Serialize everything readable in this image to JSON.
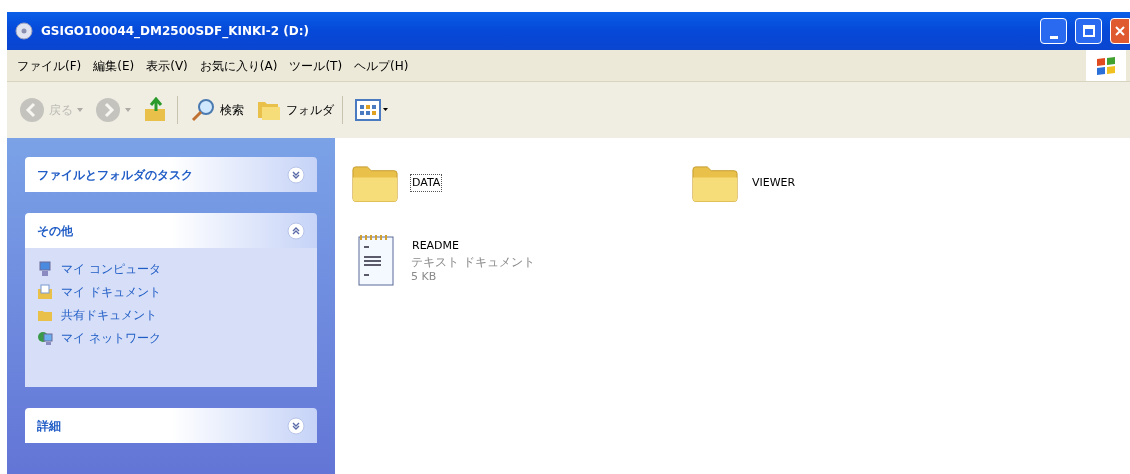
{
  "window": {
    "title": "GSIGO100044_DM2500SDF_KINKI-2 (D:)"
  },
  "menu": [
    "ファイル(F)",
    "編集(E)",
    "表示(V)",
    "お気に入り(A)",
    "ツール(T)",
    "ヘルプ(H)"
  ],
  "toolbar": [
    {
      "kind": "back",
      "label": "戻る",
      "disabled": true
    },
    {
      "kind": "forward",
      "disabled": true
    },
    {
      "kind": "up",
      "disabled": false
    },
    {
      "kind": "search",
      "label": "検索",
      "disabled": false
    },
    {
      "kind": "folders",
      "label": "フォルダ",
      "disabled": false
    },
    {
      "kind": "views",
      "disabled": false
    }
  ],
  "sidebar": [
    {
      "title": "ファイルとフォルダのタスク",
      "expanded": false
    },
    {
      "title": "その他",
      "expanded": true,
      "items": [
        {
          "kind": "computer",
          "label": "マイ コンピュータ"
        },
        {
          "kind": "documents",
          "label": "マイ ドキュメント"
        },
        {
          "kind": "shared",
          "label": "共有ドキュメント"
        },
        {
          "kind": "network",
          "label": "マイ ネットワーク"
        }
      ]
    },
    {
      "title": "詳細",
      "expanded": false
    }
  ],
  "files": [
    {
      "kind": "folder",
      "name": "DATA",
      "focused": true
    },
    {
      "kind": "folder",
      "name": "VIEWER",
      "focused": false
    },
    {
      "kind": "text",
      "name": "README",
      "type": "テキスト ドキュメント",
      "size": "5 KB",
      "focused": false
    }
  ]
}
